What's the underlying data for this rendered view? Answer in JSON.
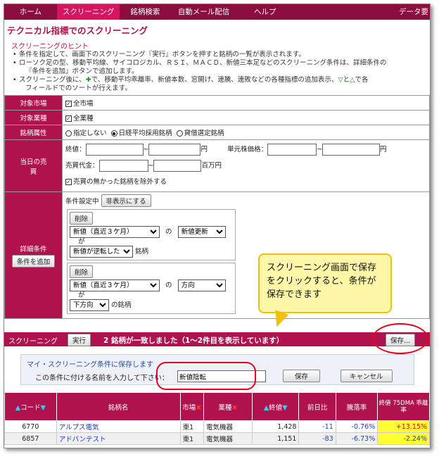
{
  "nav": [
    "ホーム",
    "スクリーニング",
    "銘柄検索",
    "自動メール配信",
    "ヘルプ",
    "データ要"
  ],
  "page_title": "テクニカル指標でのスクリーニング",
  "hint": {
    "heading": "スクリーニングのヒント",
    "l1": "条件を指定して、画面下のスクリーニング『実行』ボタンを押すと銘柄の一覧が表示されます。",
    "l2a": "ローソク足の型、移動平均線、サイコロジカル、ＲＳＩ、ＭＡＣＤ、新値三本足などのスクリーニング条件は、詳細条件の",
    "l2b": "『条件を追加』ボタンで追加します。",
    "l3a": "スクリーニング後に、",
    "l3b": "で、移動平均乖離率、新値本数、窓開け、連騰、連敗などの各種指標の追加表示、",
    "l3c": "と",
    "l3d": "で各",
    "l4": "フィールドでのソートが行えます。"
  },
  "rows": {
    "market": {
      "label": "対象市場",
      "value": "全市場"
    },
    "industry": {
      "label": "対象業種",
      "value": "全業種"
    },
    "attr": {
      "label": "銘柄属性",
      "opt1": "指定しない",
      "opt2": "日経平均採用銘柄",
      "opt3": "貸借選定銘柄"
    },
    "today": {
      "label": "当日の売買",
      "close": "終値：",
      "yen1": "円",
      "unit_price": "単元株価格：",
      "yen2": "円",
      "turnover": "売買代金：",
      "million": "百万円",
      "exclude": "売買の無かった銘柄を除外する"
    },
    "detail": {
      "label": "詳細条件",
      "add_btn": "条件を追加",
      "status": "条件設定中",
      "hide_btn": "非表示にする",
      "c1": {
        "del": "削除",
        "sel1": "新値（直近３ケ月）",
        "no": "の",
        "sel2": "新値更新",
        "ga": "が",
        "sel3": "新値が逆転した",
        "suffix": "銘柄"
      },
      "c2": {
        "del": "削除",
        "sel1": "新値（直近３ケ月）",
        "no": "の",
        "sel2": "方向",
        "ga": "が",
        "sel3": "下方向",
        "suffix": "の銘柄"
      }
    }
  },
  "callout": "スクリーニング画面で保存をクリックすると、条件が保存できます",
  "screening": {
    "label": "スクリーニング",
    "run": "実行",
    "result": "2 銘柄が一致しました（1～2件目を表示しています）",
    "save": "保存..."
  },
  "save_section": {
    "title": "マイ・スクリーニング条件に保存します",
    "prompt": "この条件に付ける名前を入力して下さい：",
    "name_value": "新値陰転",
    "save": "保存",
    "cancel": "キャンセル"
  },
  "table": {
    "headers": [
      "コード",
      "銘柄名",
      "市場",
      "業種",
      "終値",
      "前日比",
      "騰落率",
      "終値 75DMA 乖離率"
    ],
    "rows": [
      {
        "code": "6770",
        "name": "アルプス電気",
        "market": "東1",
        "industry": "電気機器",
        "close": "1,428",
        "change": "-11",
        "rate": "-0.76%",
        "dev": "+13.15%"
      },
      {
        "code": "6857",
        "name": "アドバンテスト",
        "market": "東1",
        "industry": "電気機器",
        "close": "1,151",
        "change": "-83",
        "rate": "-6.73%",
        "dev": "-2.24%"
      }
    ]
  },
  "colors": {
    "nav_bg": "#8a0d3e",
    "accent": "#b0124d",
    "active_tab": "#d6145f",
    "highlight": "#ffff33"
  }
}
